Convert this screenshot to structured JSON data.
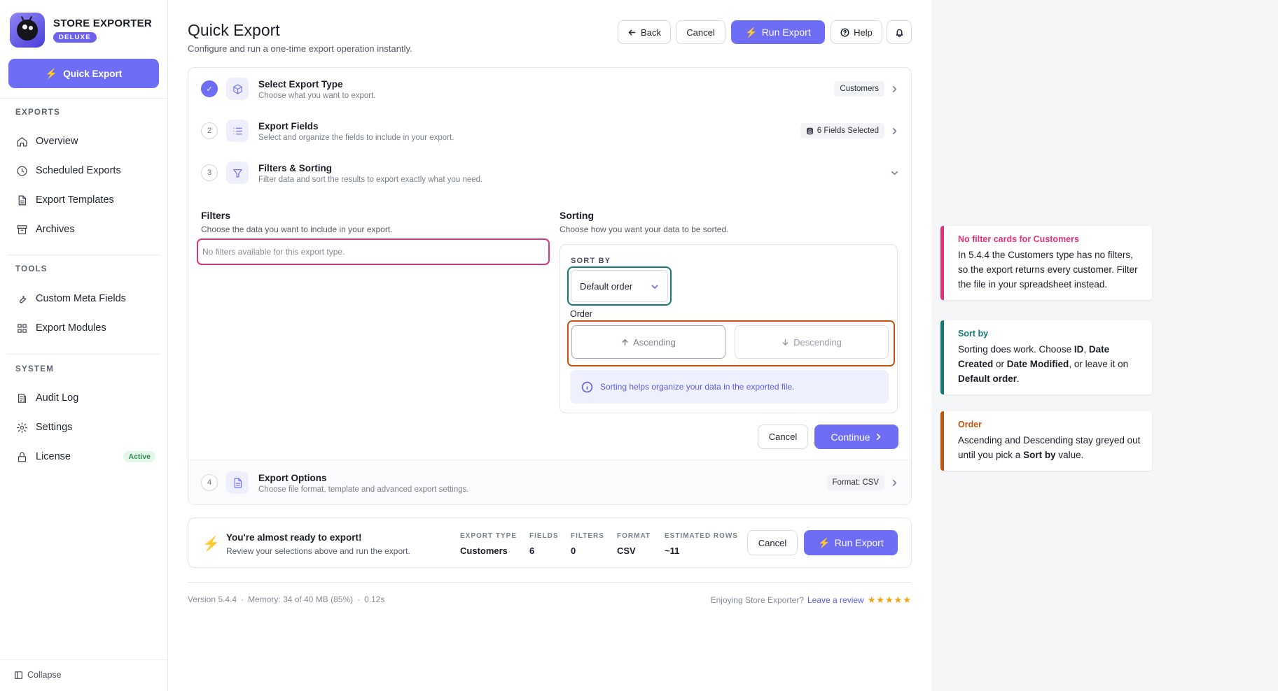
{
  "sidebar": {
    "brand_name": "STORE EXPORTER",
    "brand_badge": "DELUXE",
    "quick_export": "Quick Export",
    "sections": {
      "exports": "EXPORTS",
      "tools": "TOOLS",
      "system": "SYSTEM"
    },
    "items": {
      "overview": "Overview",
      "scheduled": "Scheduled Exports",
      "templates": "Export Templates",
      "archives": "Archives",
      "meta_fields": "Custom Meta Fields",
      "modules": "Export Modules",
      "audit_log": "Audit Log",
      "settings": "Settings",
      "license": "License"
    },
    "license_status": "Active",
    "collapse": "Collapse"
  },
  "header": {
    "title": "Quick Export",
    "subtitle": "Configure and run a one-time export operation instantly.",
    "back": "Back",
    "cancel": "Cancel",
    "run_export": "Run Export",
    "help": "Help"
  },
  "steps": [
    {
      "number": "✓",
      "title": "Select Export Type",
      "desc": "Choose what you want to export.",
      "pill": "Customers"
    },
    {
      "number": "2",
      "title": "Export Fields",
      "desc": "Select and organize the fields to include in your export.",
      "pill": "6 Fields Selected"
    },
    {
      "number": "3",
      "title": "Filters & Sorting",
      "desc": "Filter data and sort the results to export exactly what you need."
    },
    {
      "number": "4",
      "title": "Export Options",
      "desc": "Choose file format, template and advanced export settings.",
      "pill": "Format: CSV"
    }
  ],
  "filters": {
    "title": "Filters",
    "subtitle": "Choose the data you want to include in your export.",
    "empty": "No filters available for this export type."
  },
  "sorting": {
    "title": "Sorting",
    "subtitle": "Choose how you want your data to be sorted.",
    "sort_by_label": "SORT BY",
    "sort_by_value": "Default order",
    "order_label": "Order",
    "ascending": "Ascending",
    "descending": "Descending",
    "info": "Sorting helps organize your data in the exported file."
  },
  "actions": {
    "cancel": "Cancel",
    "continue": "Continue"
  },
  "summary": {
    "title": "You're almost ready to export!",
    "subtitle": "Review your selections above and run the export.",
    "stats": [
      {
        "label": "EXPORT TYPE",
        "value": "Customers"
      },
      {
        "label": "FIELDS",
        "value": "6"
      },
      {
        "label": "FILTERS",
        "value": "0"
      },
      {
        "label": "FORMAT",
        "value": "CSV"
      },
      {
        "label": "ESTIMATED ROWS",
        "value": "~11"
      }
    ],
    "cancel": "Cancel",
    "run_export": "Run Export"
  },
  "footer": {
    "version": "Version 5.4.4",
    "memory": "Memory: 34 of 40 MB (85%)",
    "time": "0.12s",
    "enjoying": "Enjoying Store Exporter?",
    "review_link": "Leave a review",
    "stars": "★★★★★"
  },
  "annotations": [
    {
      "title": "No filter cards for Customers",
      "color": "#e0337a"
    },
    {
      "title": "Sort by",
      "color": "#127a73"
    },
    {
      "title": "Order",
      "color": "#c2560e"
    }
  ],
  "colors": {
    "accent": "#6d6df5",
    "filters_highlight": "#e0337a",
    "sortby_highlight": "#127a73",
    "order_highlight": "#c2560e"
  }
}
